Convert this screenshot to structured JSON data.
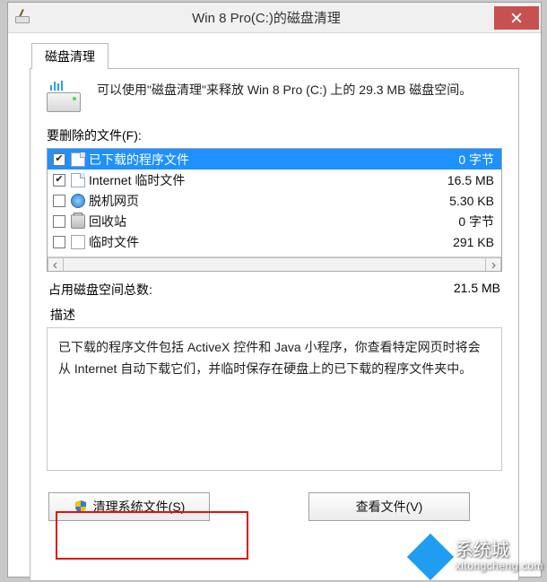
{
  "titlebar": {
    "title": "Win 8 Pro(C:)的磁盘清理"
  },
  "tab": {
    "label": "磁盘清理"
  },
  "intro": "可以使用\"磁盘清理\"来释放 Win 8 Pro (C:) 上的 29.3 MB 磁盘空间。",
  "files_label": "要删除的文件(F):",
  "files": [
    {
      "checked": true,
      "icon": "page",
      "name": "已下载的程序文件",
      "size": "0 字节",
      "selected": true
    },
    {
      "checked": true,
      "icon": "page",
      "name": "Internet 临时文件",
      "size": "16.5 MB",
      "selected": false
    },
    {
      "checked": false,
      "icon": "globe",
      "name": "脱机网页",
      "size": "5.30 KB",
      "selected": false
    },
    {
      "checked": false,
      "icon": "bin",
      "name": "回收站",
      "size": "0 字节",
      "selected": false
    },
    {
      "checked": false,
      "icon": "file",
      "name": "临时文件",
      "size": "291 KB",
      "selected": false
    }
  ],
  "total": {
    "label": "占用磁盘空间总数:",
    "value": "21.5 MB"
  },
  "description": {
    "label": "描述",
    "text": "已下载的程序文件包括 ActiveX 控件和 Java 小程序，你查看特定网页时将会从 Internet 自动下载它们，并临时保存在硬盘上的已下载的程序文件夹中。"
  },
  "buttons": {
    "clean_system": "清理系统文件(S)",
    "view_files": "查看文件(V)"
  },
  "watermark": {
    "brand": "系统城",
    "url": "xitongcheng.com"
  }
}
